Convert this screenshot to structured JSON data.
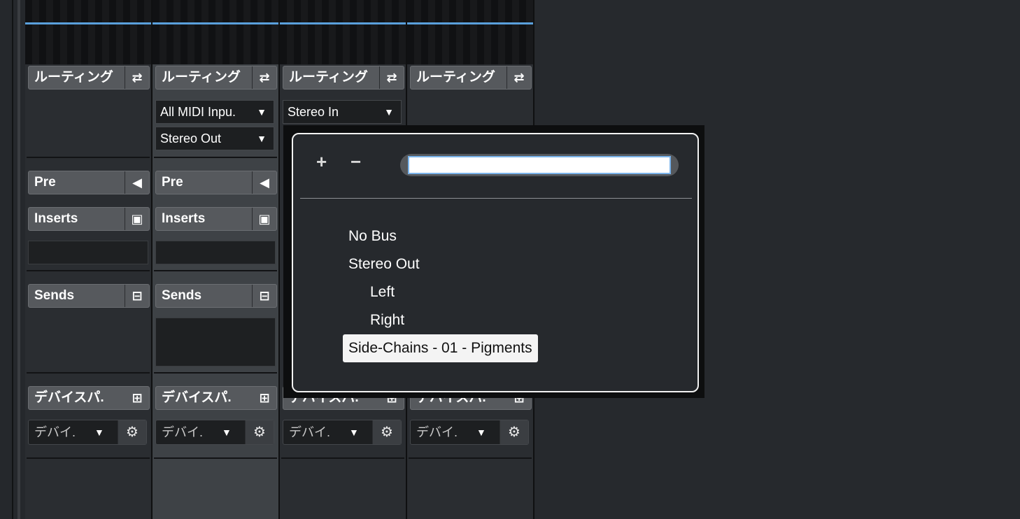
{
  "strips": [
    {
      "routing_label": "ルーティング",
      "routing_icon": "routing-icon",
      "inputs": [],
      "pre_label": "Pre",
      "inserts_label": "Inserts",
      "sends_label": "Sends",
      "device_label": "デバイスパ.",
      "device_select": "デバイ."
    },
    {
      "routing_label": "ルーティング",
      "routing_icon": "routing-icon",
      "inputs": [
        "All MIDI Inpu.",
        "Stereo Out"
      ],
      "pre_label": "Pre",
      "inserts_label": "Inserts",
      "sends_label": "Sends",
      "device_label": "デバイスパ.",
      "device_select": "デバイ."
    },
    {
      "routing_label": "ルーティング",
      "routing_icon": "routing-icon",
      "inputs": [
        "Stereo In"
      ],
      "device_label": "デバイスパ.",
      "device_select": "デバイ."
    },
    {
      "routing_label": "ルーティング",
      "routing_icon": "routing-icon",
      "inputs": [],
      "device_label": "デバイスパ.",
      "device_select": "デバイ."
    }
  ],
  "popup": {
    "add_symbol": "+",
    "remove_symbol": "−",
    "search_value": "",
    "items": [
      {
        "label": "No Bus",
        "indent": 0,
        "highlighted": false
      },
      {
        "label": "Stereo Out",
        "indent": 0,
        "highlighted": false
      },
      {
        "label": "Left",
        "indent": 1,
        "highlighted": false
      },
      {
        "label": "Right",
        "indent": 1,
        "highlighted": false
      },
      {
        "label": "Side-Chains - 01 - Pigments",
        "indent": 0,
        "highlighted": true
      }
    ]
  },
  "colors": {
    "accent": "#5aa0dc",
    "highlight": "#f4f4f4"
  }
}
